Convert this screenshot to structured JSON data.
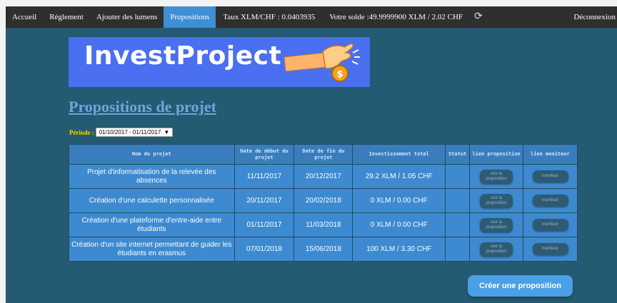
{
  "nav": {
    "items": [
      {
        "label": "Accueil",
        "active": false
      },
      {
        "label": "Réglement",
        "active": false
      },
      {
        "label": "Ajouter des lumens",
        "active": false
      },
      {
        "label": "Propositions",
        "active": true
      }
    ],
    "rate": "Taux XLM/CHF : 0.0403935",
    "balance": "Votre solde :49.9999900 XLM / 2.02 CHF",
    "logout": "Déconnexion"
  },
  "banner": {
    "title": "InvestProject",
    "icon": "hand-coin-icon"
  },
  "page": {
    "title": "Propositions de projet",
    "period_label": "Période :",
    "period_value": "01/10/2017 - 01/11/2017"
  },
  "table": {
    "headers": [
      "Nom du projet",
      "Date de début du projet",
      "Date de fin du projet",
      "Investissement total",
      "Statut",
      "lien proposition",
      "lien moniteur"
    ],
    "rows": [
      {
        "name": "Projet d'informatisation de la relevée des absences",
        "start": "11/11/2017",
        "end": "20/12/2017",
        "total": "29.2 XLM / 1.05 CHF",
        "status": "",
        "view_label": "voir la proposition",
        "monitor_label": "moniteur"
      },
      {
        "name": "Création d'une calculette personnalisée",
        "start": "20/11/2017",
        "end": "20/02/2018",
        "total": "0 XLM / 0.00 CHF",
        "status": "",
        "view_label": "voir la proposition",
        "monitor_label": "moniteur"
      },
      {
        "name": "Création d'une plateforme d'entre-aide entre étudiants",
        "start": "01/11/2017",
        "end": "11/03/2018",
        "total": "0 XLM / 0.00 CHF",
        "status": "",
        "view_label": "voir la proposition",
        "monitor_label": "moniteur"
      },
      {
        "name": "Création d'un site internet permettant de guider les étudiants en erasmus",
        "start": "07/01/2018",
        "end": "15/06/2018",
        "total": "100 XLM / 3.30 CHF",
        "status": "",
        "view_label": "voir la proposition",
        "monitor_label": "moniteur"
      }
    ]
  },
  "actions": {
    "create_label": "Créer une proposition"
  },
  "colors": {
    "navbar": "#2f2f2f",
    "active_tab": "#3d8fd6",
    "background": "#245a72",
    "banner": "#4a6ff0",
    "table_cell": "#3d8ad0",
    "accent": "#4aa0e6"
  }
}
